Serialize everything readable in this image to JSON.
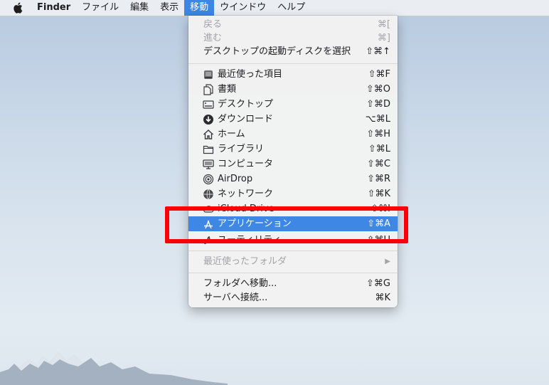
{
  "menubar": {
    "apple_icon": "apple-logo",
    "app_name": "Finder",
    "items": [
      "ファイル",
      "編集",
      "表示",
      "移動",
      "ウインドウ",
      "ヘルプ"
    ],
    "active_index": 3
  },
  "go_menu": {
    "back": {
      "label": "戻る",
      "shortcut": "⌘["
    },
    "forward": {
      "label": "進む",
      "shortcut": "⌘]"
    },
    "desktop_startup": {
      "label": "デスクトップの起動ディスクを選択",
      "shortcut": "⇧⌘↑"
    },
    "locations": [
      {
        "label": "最近使った項目",
        "shortcut": "⇧⌘F",
        "icon": "recents-icon"
      },
      {
        "label": "書類",
        "shortcut": "⇧⌘O",
        "icon": "documents-icon"
      },
      {
        "label": "デスクトップ",
        "shortcut": "⇧⌘D",
        "icon": "desktop-icon"
      },
      {
        "label": "ダウンロード",
        "shortcut": "⌥⌘L",
        "icon": "download-icon"
      },
      {
        "label": "ホーム",
        "shortcut": "⇧⌘H",
        "icon": "home-icon"
      },
      {
        "label": "ライブラリ",
        "shortcut": "⇧⌘L",
        "icon": "folder-icon"
      },
      {
        "label": "コンピュータ",
        "shortcut": "⇧⌘C",
        "icon": "computer-icon"
      },
      {
        "label": "AirDrop",
        "shortcut": "⇧⌘R",
        "icon": "airdrop-icon"
      },
      {
        "label": "ネットワーク",
        "shortcut": "⇧⌘K",
        "icon": "network-icon"
      },
      {
        "label": "iCloud Drive",
        "shortcut": "⇧⌘I",
        "icon": "icloud-icon"
      },
      {
        "label": "アプリケーション",
        "shortcut": "⇧⌘A",
        "icon": "applications-icon"
      },
      {
        "label": "ユーティリティ",
        "shortcut": "⇧⌘U",
        "icon": "utilities-icon"
      }
    ],
    "selected_index": 10,
    "recent_folders": {
      "label": "最近使ったフォルダ",
      "submenu_arrow": "▶"
    },
    "go_to_folder": {
      "label": "フォルダへ移動...",
      "shortcut": "⇧⌘G"
    },
    "connect_server": {
      "label": "サーバへ接続...",
      "shortcut": "⌘K"
    }
  },
  "colors": {
    "selection": "#3f87e5",
    "highlight_box": "#fb0007",
    "menubar_active": "#3e86e4"
  }
}
